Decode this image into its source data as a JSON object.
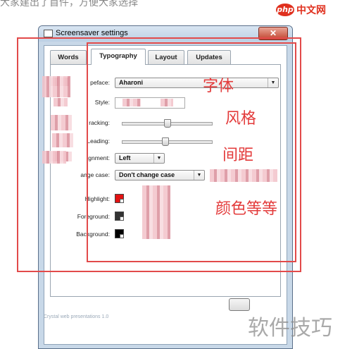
{
  "page_caption": "大家建出了首件，方便大家选择",
  "site_logo": {
    "badge": "php",
    "text": "中文网"
  },
  "window": {
    "title": "Screensaver settings",
    "close_label": "✕"
  },
  "tabs": [
    {
      "label": "Words",
      "active": false
    },
    {
      "label": "Typography",
      "active": true
    },
    {
      "label": "Layout",
      "active": false
    },
    {
      "label": "Updates",
      "active": false
    }
  ],
  "typography": {
    "typeface": {
      "label": "peface:",
      "value": "Aharoni"
    },
    "style": {
      "label": "Style:"
    },
    "tracking": {
      "label": "racking:",
      "level": 0.5
    },
    "leading": {
      "label": "Leading:",
      "level": 0.48
    },
    "alignment": {
      "label": "gnment:",
      "value": "Left"
    },
    "change_case": {
      "label": "ange case:",
      "value": "Don't change case"
    },
    "colors": {
      "highlight": {
        "label": "Highlight:",
        "color": "#e31212"
      },
      "foreground": {
        "label": "Foreground:",
        "color": "#333333"
      },
      "background": {
        "label": "Background:",
        "color": "#000000"
      }
    }
  },
  "footer": {
    "copyright": "Crystal web presentations 1.0"
  },
  "annotations": {
    "font": "字体",
    "style": "风格",
    "spacing": "间距",
    "colors": "颜色等等"
  },
  "watermark": "软件技巧",
  "icons": {
    "dropdown": "chevron-down-icon",
    "app": "window-icon",
    "close": "close-icon"
  },
  "accent_colors": {
    "annotation_red": "#e24a4a",
    "window_frame": "#c8d8e8"
  }
}
